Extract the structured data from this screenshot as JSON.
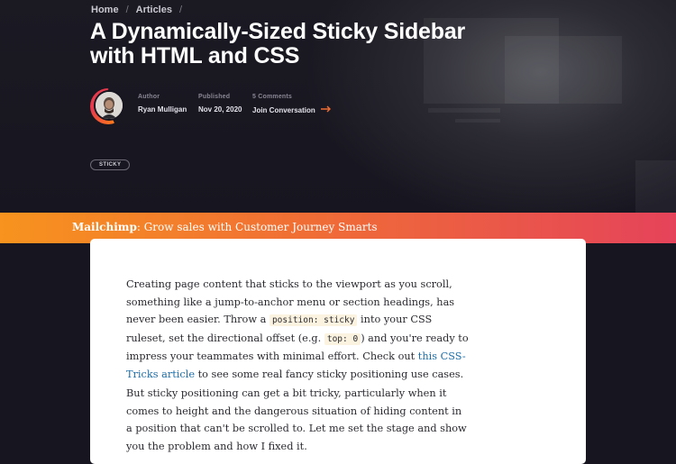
{
  "breadcrumb": {
    "home": "Home",
    "separator": "/",
    "articles": "Articles",
    "trailing": "/"
  },
  "article": {
    "title_line1": "A Dynamically-Sized Sticky Sidebar",
    "title_line2": "with HTML and CSS",
    "author_label": "Author",
    "author_name": "Ryan Mulligan",
    "published_label": "Published",
    "published_date": "Nov 20, 2020",
    "comments_label": "5 Comments",
    "join_label": "Join Conversation",
    "tag": "STICKY"
  },
  "promo": {
    "brand": "Mailchimp",
    "text": ": Grow sales with Customer Journey Smarts"
  },
  "body": {
    "p1": {
      "t1": "Creating page content that sticks to the viewport as you scroll, something like a jump-to-anchor menu or section headings, has never been easier. Throw a ",
      "code1": "position: sticky",
      "t2": " into your CSS ruleset, set the directional offset (e.g. ",
      "code2": "top: 0",
      "t3": ") and you're ready to impress your teammates with minimal effort. Check out ",
      "link": "this CSS-Tricks article",
      "t4": " to see some real fancy sticky positioning use cases."
    },
    "p2": "But sticky positioning can get a bit tricky, particularly when it comes to height and the dangerous situation of hiding content in a position that can't be scrolled to. Let me set the stage and show you the problem and how I fixed it."
  },
  "colors": {
    "accent_orange": "#f7931e",
    "accent_pink": "#e5435a",
    "link": "#1e6ea8",
    "background": "#17151f"
  }
}
